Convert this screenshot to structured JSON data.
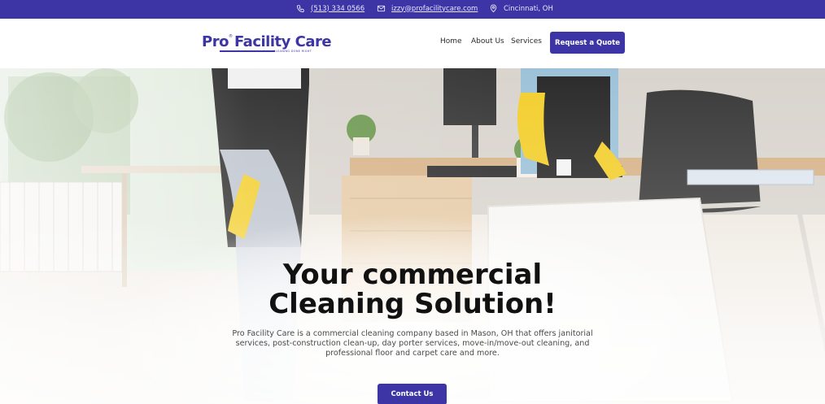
{
  "topbar": {
    "phone": "(513) 334 0566",
    "email": "izzy@profacilitycare.com",
    "location": "Cincinnati, OH",
    "icons": {
      "phone": "phone-icon",
      "email": "envelope-icon",
      "location": "map-pin-icon"
    }
  },
  "header": {
    "logo": {
      "part1": "Pro",
      "reg": "®",
      "part2": "Facility Care",
      "tagline": "CLEANING DONE RIGHT"
    },
    "nav": [
      "Home",
      "About Us",
      "Services"
    ],
    "cta_label": "Request a Quote"
  },
  "hero": {
    "headline_line1": "Your commercial",
    "headline_line2": "Cleaning Solution!",
    "description": "Pro Facility Care is a commercial cleaning company based in Mason, OH that offers janitorial services, post-construction clean-up, day porter services, move-in/move-out cleaning, and professional floor and carpet care and more.",
    "contact_label": "Contact Us"
  },
  "colors": {
    "brand": "#3d35a6",
    "text": "#111111",
    "body_text": "#4a4a4a",
    "white": "#ffffff"
  }
}
